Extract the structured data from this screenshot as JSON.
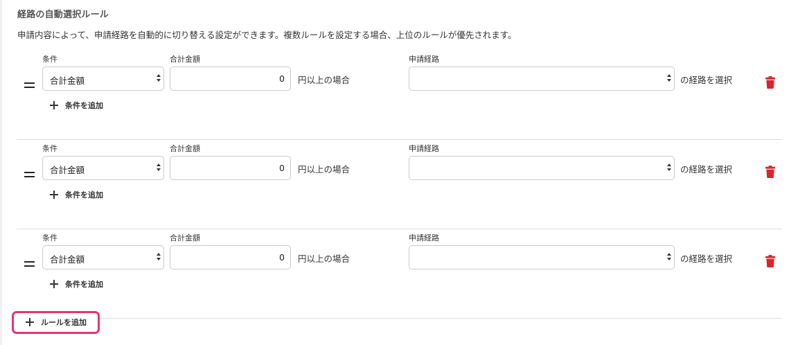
{
  "section": {
    "title": "経路の自動選択ルール",
    "description": "申請内容によって、申請経路を自動的に切り替える設定ができます。複数ルールを設定する場合、上位のルールが優先されます。"
  },
  "labels": {
    "condition": "条件",
    "amount": "合計金額",
    "route": "申請経路",
    "amount_suffix": "円以上の場合",
    "route_suffix": "の経路を選択",
    "add_condition": "条件を追加",
    "add_rule": "ルールを追加"
  },
  "rules": [
    {
      "condition": "合計金額",
      "amount": "0",
      "route": ""
    },
    {
      "condition": "合計金額",
      "amount": "0",
      "route": ""
    },
    {
      "condition": "合計金額",
      "amount": "0",
      "route": ""
    }
  ],
  "colors": {
    "delete_icon": "#d9262c",
    "highlight_border": "#e8336b"
  },
  "icons": {
    "drag": "drag-handle-icon",
    "delete": "trash-icon",
    "add": "plus-icon"
  }
}
